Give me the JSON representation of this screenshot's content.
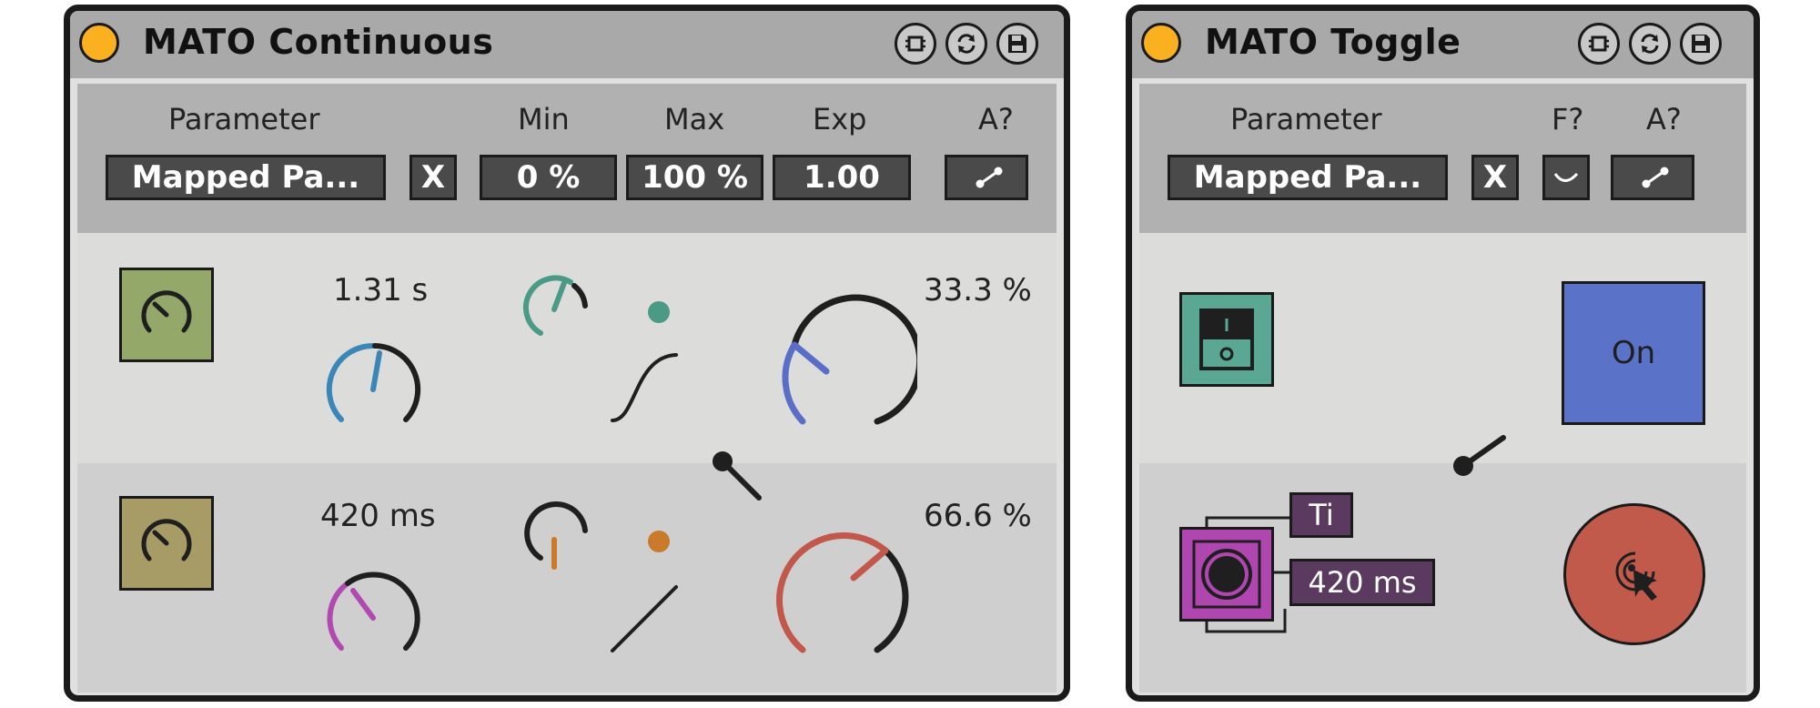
{
  "continuous": {
    "title": "MATO Continuous",
    "header_labels": {
      "parameter": "Parameter",
      "min": "Min",
      "max": "Max",
      "exp": "Exp",
      "a": "A?"
    },
    "mapped_param": "Mapped Pa...",
    "clear_label": "X",
    "min_value": "0 %",
    "max_value": "100 %",
    "exp_value": "1.00",
    "row1": {
      "time": "1.31 s",
      "amount": "33.3 %"
    },
    "row2": {
      "time": "420 ms",
      "amount": "66.6 %"
    }
  },
  "toggle": {
    "title": "MATO Toggle",
    "header_labels": {
      "parameter": "Parameter",
      "f": "F?",
      "a": "A?"
    },
    "mapped_param": "Mapped Pa...",
    "clear_label": "X",
    "on_label": "On",
    "ti_label": "Ti",
    "time_value": "420 ms"
  },
  "colors": {
    "device_bg": "#e0e0e0",
    "titlebar": "#a9a9a9",
    "led_orange": "#fbb01f",
    "olive_icon": "#94a86a",
    "khaki_icon": "#a89c66",
    "teal_knob": "#4a9a86",
    "blue_knob": "#3a86b6",
    "periwinkle_knob": "#5a6ec8",
    "magenta_knob": "#b04ab0",
    "salmon_knob": "#c2584c",
    "orange_dot": "#c97a2a",
    "toggle_on_blue": "#5a73c8",
    "toggle_icon_teal": "#5aa894",
    "toggle_icon_magenta": "#b046b0",
    "toggle_red": "#c25a4c",
    "label_purple": "#5a3a5e"
  },
  "icons": [
    "record-icon",
    "refresh-icon",
    "save-icon",
    "knob-icon",
    "map-curve-icon",
    "toggle-switch-icon",
    "target-cursor-icon"
  ]
}
